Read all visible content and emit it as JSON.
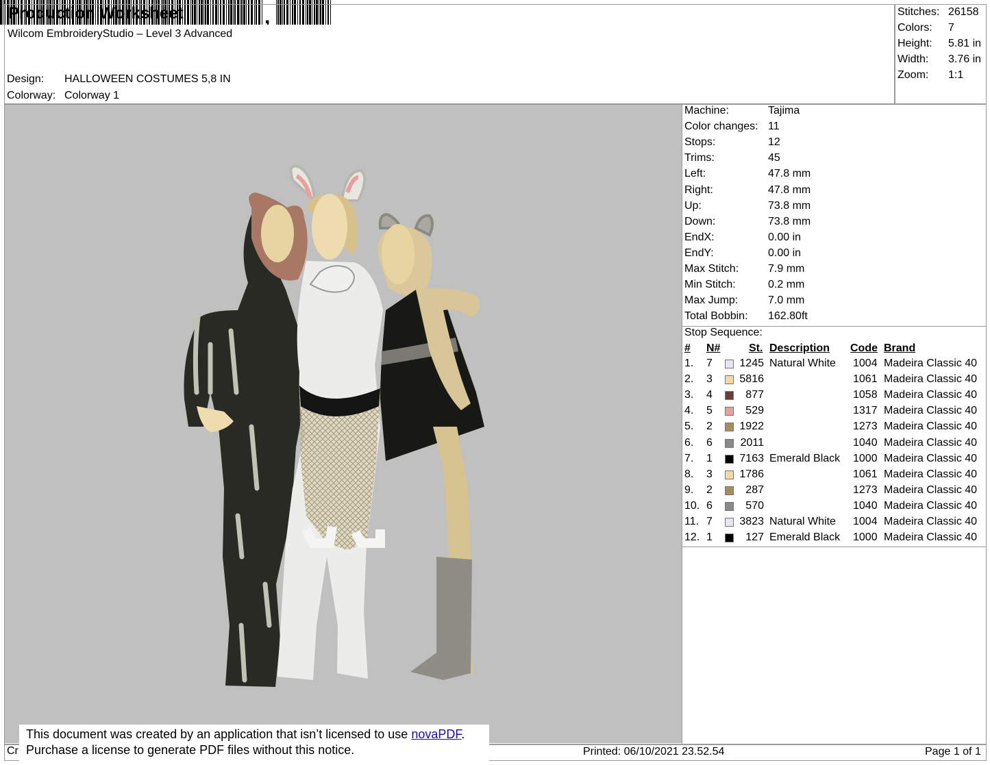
{
  "header": {
    "title": "Production Worksheet",
    "app": "Wilcom EmbroideryStudio – Level 3 Advanced",
    "design_label": "Design:",
    "design_value": "HALLOWEEN COSTUMES 5,8 IN",
    "colorway_label": "Colorway:",
    "colorway_value": "Colorway 1"
  },
  "stats": [
    {
      "label": "Stitches:",
      "value": "26158"
    },
    {
      "label": "Colors:",
      "value": "7"
    },
    {
      "label": "Height:",
      "value": "5.81 in"
    },
    {
      "label": "Width:",
      "value": "3.76 in"
    },
    {
      "label": "Zoom:",
      "value": "1:1"
    }
  ],
  "machine": [
    {
      "label": "Machine:",
      "value": "Tajima"
    },
    {
      "label": "Color changes:",
      "value": "11"
    },
    {
      "label": "Stops:",
      "value": "12"
    },
    {
      "label": "Trims:",
      "value": "45"
    },
    {
      "label": "Left:",
      "value": "47.8 mm"
    },
    {
      "label": "Right:",
      "value": "47.8 mm"
    },
    {
      "label": "Up:",
      "value": "73.8 mm"
    },
    {
      "label": "Down:",
      "value": "73.8 mm"
    },
    {
      "label": "EndX:",
      "value": "0.00 in"
    },
    {
      "label": "EndY:",
      "value": "0.00 in"
    },
    {
      "label": "Max Stitch:",
      "value": "7.9 mm"
    },
    {
      "label": "Min Stitch:",
      "value": "0.2 mm"
    },
    {
      "label": "Max Jump:",
      "value": "7.0 mm"
    },
    {
      "label": "Total Bobbin:",
      "value": "162.80ft"
    }
  ],
  "stop_sequence": {
    "title": "Stop Sequence:",
    "headers": {
      "num": "#",
      "needle": "N#",
      "st": "St.",
      "desc": "Description",
      "code": "Code",
      "brand": "Brand"
    },
    "rows": [
      {
        "num": "1.",
        "needle": "7",
        "color": "#e6e6ee",
        "st": "1245",
        "desc": "Natural White",
        "code": "1004",
        "brand": "Madeira Classic 40"
      },
      {
        "num": "2.",
        "needle": "3",
        "color": "#f6d9a0",
        "st": "5816",
        "desc": "",
        "code": "1061",
        "brand": "Madeira Classic 40"
      },
      {
        "num": "3.",
        "needle": "4",
        "color": "#6e3c34",
        "st": "877",
        "desc": "",
        "code": "1058",
        "brand": "Madeira Classic 40"
      },
      {
        "num": "4.",
        "needle": "5",
        "color": "#e8a09c",
        "st": "529",
        "desc": "",
        "code": "1317",
        "brand": "Madeira Classic 40"
      },
      {
        "num": "5.",
        "needle": "2",
        "color": "#a88c5c",
        "st": "1922",
        "desc": "",
        "code": "1273",
        "brand": "Madeira Classic 40"
      },
      {
        "num": "6.",
        "needle": "6",
        "color": "#8a8a8a",
        "st": "2011",
        "desc": "",
        "code": "1040",
        "brand": "Madeira Classic 40"
      },
      {
        "num": "7.",
        "needle": "1",
        "color": "#000000",
        "st": "7163",
        "desc": "Emerald Black",
        "code": "1000",
        "brand": "Madeira Classic 40"
      },
      {
        "num": "8.",
        "needle": "3",
        "color": "#f6d9a0",
        "st": "1786",
        "desc": "",
        "code": "1061",
        "brand": "Madeira Classic 40"
      },
      {
        "num": "9.",
        "needle": "2",
        "color": "#a88c5c",
        "st": "287",
        "desc": "",
        "code": "1273",
        "brand": "Madeira Classic 40"
      },
      {
        "num": "10.",
        "needle": "6",
        "color": "#8a8a8a",
        "st": "570",
        "desc": "",
        "code": "1040",
        "brand": "Madeira Classic 40"
      },
      {
        "num": "11.",
        "needle": "7",
        "color": "#e6e6ee",
        "st": "3823",
        "desc": "Natural White",
        "code": "1004",
        "brand": "Madeira Classic 40"
      },
      {
        "num": "12.",
        "needle": "1",
        "color": "#000000",
        "st": "127",
        "desc": "Emerald Black",
        "code": "1000",
        "brand": "Madeira Classic 40"
      }
    ]
  },
  "footer": {
    "left_fragment": "Cr",
    "printed": "Printed: 06/10/2021 23.52.54",
    "page": "Page 1 of 1"
  },
  "notice": {
    "line1_pre": "This document was created by an application that isn’t licensed to use ",
    "link": "novaPDF",
    "line1_post": ".",
    "line2": "Purchase a license to generate PDF files without this notice."
  },
  "colors": {
    "canvas_bg": "#c0c0c1",
    "border": "#9a9a9a",
    "link": "#1a0dab"
  }
}
